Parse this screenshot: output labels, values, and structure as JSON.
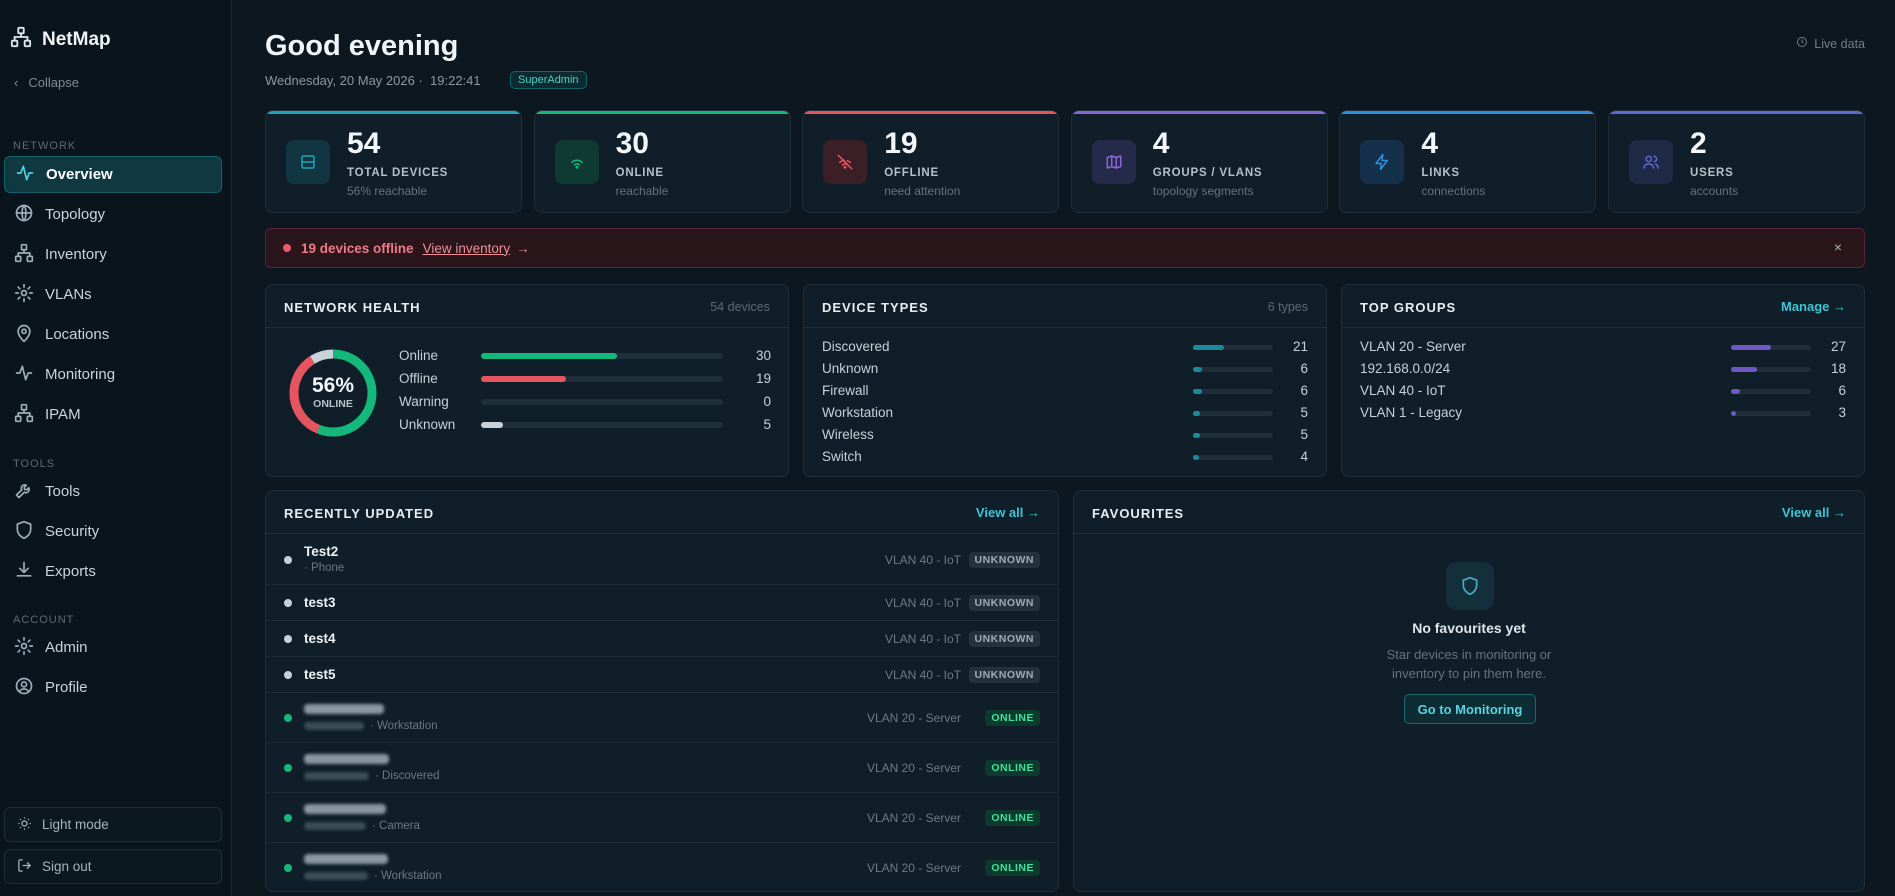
{
  "app": {
    "name": "NetMap"
  },
  "sidebar": {
    "collapse_label": "Collapse",
    "sections": {
      "network": "NETWORK",
      "tools": "TOOLS",
      "account": "ACCOUNT"
    },
    "items": [
      {
        "label": "Overview",
        "icon": "activity-icon"
      },
      {
        "label": "Topology",
        "icon": "globe-icon"
      },
      {
        "label": "Inventory",
        "icon": "network-icon"
      },
      {
        "label": "VLANs",
        "icon": "gear-icon"
      },
      {
        "label": "Locations",
        "icon": "map-pin-icon"
      },
      {
        "label": "Monitoring",
        "icon": "activity-icon"
      },
      {
        "label": "IPAM",
        "icon": "network-icon"
      },
      {
        "label": "Tools",
        "icon": "wrench-icon"
      },
      {
        "label": "Security",
        "icon": "shield-icon"
      },
      {
        "label": "Exports",
        "icon": "download-icon"
      },
      {
        "label": "Admin",
        "icon": "gear-icon"
      },
      {
        "label": "Profile",
        "icon": "user-circle-icon"
      }
    ],
    "light_mode_label": "Light mode",
    "sign_out_label": "Sign out"
  },
  "header": {
    "greeting": "Good evening",
    "date": "Wednesday, 20 May 2026 ·",
    "time": "19:22:41",
    "role": "SuperAdmin",
    "live_label": "Live data"
  },
  "stats": [
    {
      "value": "54",
      "label": "TOTAL DEVICES",
      "sub": "56% reachable",
      "color": "#1fa5b8"
    },
    {
      "value": "30",
      "label": "ONLINE",
      "sub": "reachable",
      "color": "#14b87a"
    },
    {
      "value": "19",
      "label": "OFFLINE",
      "sub": "need attention",
      "color": "#e5555f"
    },
    {
      "value": "4",
      "label": "GROUPS / VLANS",
      "sub": "topology segments",
      "color": "#8a67d8"
    },
    {
      "value": "4",
      "label": "LINKS",
      "sub": "connections",
      "color": "#2f8fdc"
    },
    {
      "value": "2",
      "label": "USERS",
      "sub": "accounts",
      "color": "#5c6bd6"
    }
  ],
  "alert": {
    "message": "19 devices offline",
    "link": "View inventory",
    "arrow": "→",
    "close": "×"
  },
  "health": {
    "title": "NETWORK HEALTH",
    "meta": "54 devices",
    "percent": "56%",
    "percent_label": "ONLINE",
    "rows": [
      {
        "label": "Online",
        "value": "30",
        "fraction": 0.56,
        "color": "#14b87a"
      },
      {
        "label": "Offline",
        "value": "19",
        "fraction": 0.35,
        "color": "#e5555f"
      },
      {
        "label": "Warning",
        "value": "0",
        "fraction": 0,
        "color": "#e5a93b"
      },
      {
        "label": "Unknown",
        "value": "5",
        "fraction": 0.09,
        "color": "#c9d2d9"
      }
    ]
  },
  "device_types": {
    "title": "DEVICE TYPES",
    "meta": "6 types",
    "rows": [
      {
        "label": "Discovered",
        "value": "21",
        "fraction": 0.39
      },
      {
        "label": "Unknown",
        "value": "6",
        "fraction": 0.11
      },
      {
        "label": "Firewall",
        "value": "6",
        "fraction": 0.11
      },
      {
        "label": "Workstation",
        "value": "5",
        "fraction": 0.09
      },
      {
        "label": "Wireless",
        "value": "5",
        "fraction": 0.09
      },
      {
        "label": "Switch",
        "value": "4",
        "fraction": 0.07
      }
    ]
  },
  "top_groups": {
    "title": "TOP GROUPS",
    "link": "Manage →",
    "rows": [
      {
        "label": "VLAN 20 - Server",
        "value": "27",
        "fraction": 0.5
      },
      {
        "label": "192.168.0.0/24",
        "value": "18",
        "fraction": 0.33
      },
      {
        "label": "VLAN 40 - IoT",
        "value": "6",
        "fraction": 0.11
      },
      {
        "label": "VLAN 1 - Legacy",
        "value": "3",
        "fraction": 0.06
      }
    ]
  },
  "recent": {
    "title": "RECENTLY UPDATED",
    "link": "View all →",
    "rows": [
      {
        "name": "Test2",
        "type": "· Phone",
        "group": "VLAN 40 - IoT",
        "status": "UNKNOWN"
      },
      {
        "name": "test3",
        "type": "",
        "group": "VLAN 40 - IoT",
        "status": "UNKNOWN"
      },
      {
        "name": "test4",
        "type": "",
        "group": "VLAN 40 - IoT",
        "status": "UNKNOWN"
      },
      {
        "name": "test5",
        "type": "",
        "group": "VLAN 40 - IoT",
        "status": "UNKNOWN"
      },
      {
        "name": "",
        "type": "· Workstation",
        "group": "VLAN 20 - Server",
        "status": "ONLINE"
      },
      {
        "name": "",
        "type": "· Discovered",
        "group": "VLAN 20 - Server",
        "status": "ONLINE"
      },
      {
        "name": "",
        "type": "· Camera",
        "group": "VLAN 20 - Server",
        "status": "ONLINE"
      },
      {
        "name": "",
        "type": "· Workstation",
        "group": "VLAN 20 - Server",
        "status": "ONLINE"
      }
    ]
  },
  "favourites": {
    "title": "FAVOURITES",
    "link": "View all →",
    "empty_title": "No favourites yet",
    "empty_text": "Star devices in monitoring or inventory to pin them here.",
    "button": "Go to Monitoring"
  }
}
